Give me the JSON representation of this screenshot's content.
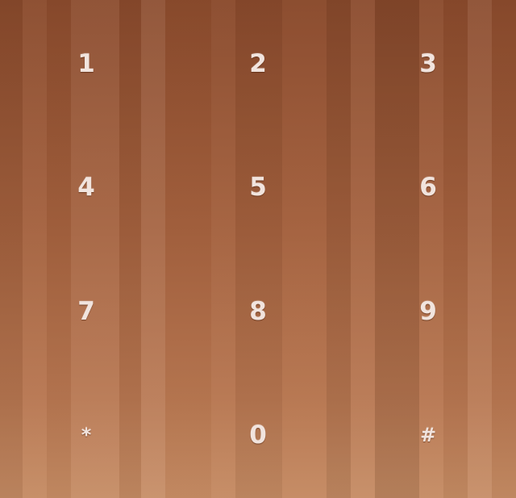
{
  "keypad": {
    "keys": [
      {
        "label": "1"
      },
      {
        "label": "2"
      },
      {
        "label": "3"
      },
      {
        "label": "4"
      },
      {
        "label": "5"
      },
      {
        "label": "6"
      },
      {
        "label": "7"
      },
      {
        "label": "8"
      },
      {
        "label": "9"
      },
      {
        "label": "*"
      },
      {
        "label": "0"
      },
      {
        "label": "#"
      }
    ]
  },
  "colors": {
    "background_top": "#8a4a2c",
    "background_bottom": "#c58b63",
    "key_text": "#f1e4de"
  }
}
